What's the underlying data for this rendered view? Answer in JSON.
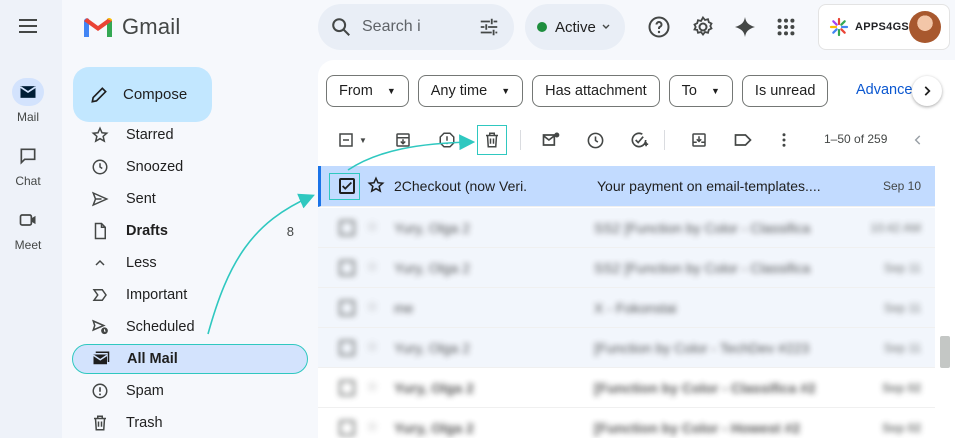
{
  "app": {
    "name": "Gmail"
  },
  "rail": {
    "items": [
      {
        "label": "Mail",
        "icon": "mail-icon"
      },
      {
        "label": "Chat",
        "icon": "chat-icon"
      },
      {
        "label": "Meet",
        "icon": "meet-icon"
      }
    ]
  },
  "header": {
    "search_placeholder": "Search i",
    "status_label": "Active",
    "account_name": "APPS4GS"
  },
  "compose_label": "Compose",
  "nav": {
    "items": [
      {
        "label": "Starred",
        "icon": "star-icon"
      },
      {
        "label": "Snoozed",
        "icon": "clock-icon"
      },
      {
        "label": "Sent",
        "icon": "send-icon"
      },
      {
        "label": "Drafts",
        "icon": "draft-icon",
        "count": "8"
      },
      {
        "label": "Less",
        "icon": "chevron-up-icon"
      },
      {
        "label": "Important",
        "icon": "important-icon"
      },
      {
        "label": "Scheduled",
        "icon": "scheduled-icon"
      },
      {
        "label": "All Mail",
        "icon": "all-mail-icon"
      },
      {
        "label": "Spam",
        "icon": "spam-icon"
      },
      {
        "label": "Trash",
        "icon": "trash-icon"
      }
    ]
  },
  "filters": {
    "chips": [
      "From",
      "Any time",
      "Has attachment",
      "To",
      "Is unread"
    ],
    "advanced_label": "Advance"
  },
  "toolbar": {
    "pager": "1–50 of 259"
  },
  "emails": [
    {
      "sender": "2Checkout (now Veri.",
      "subject": "Your payment on email-templates....",
      "date": "Sep 10"
    },
    {
      "sender": "Yury, Olga 2",
      "subject": "SS2 [Function by Color - Classifica",
      "date": "10:42 AM"
    },
    {
      "sender": "Yury, Olga 2",
      "subject": "SS2 [Function by Color - Classifica",
      "date": "Sep 11"
    },
    {
      "sender": "me",
      "subject": "X - Fokonstai",
      "date": "Sep 11"
    },
    {
      "sender": "Yury, Olga 2",
      "subject": "[Function by Color - TechDev #223",
      "date": "Sep 11"
    },
    {
      "sender": "Yury, Olga 2",
      "subject": "[Function by Color - Classifica #2",
      "date": "Sep 02"
    },
    {
      "sender": "Yury, Olga 2",
      "subject": "[Function by Color - Howest #2",
      "date": "Sep 02"
    }
  ],
  "colors": {
    "accent": "#0b57d0",
    "highlight": "#2fc8c0",
    "selected_row": "#c2dbff",
    "compose": "#c2e7ff"
  }
}
